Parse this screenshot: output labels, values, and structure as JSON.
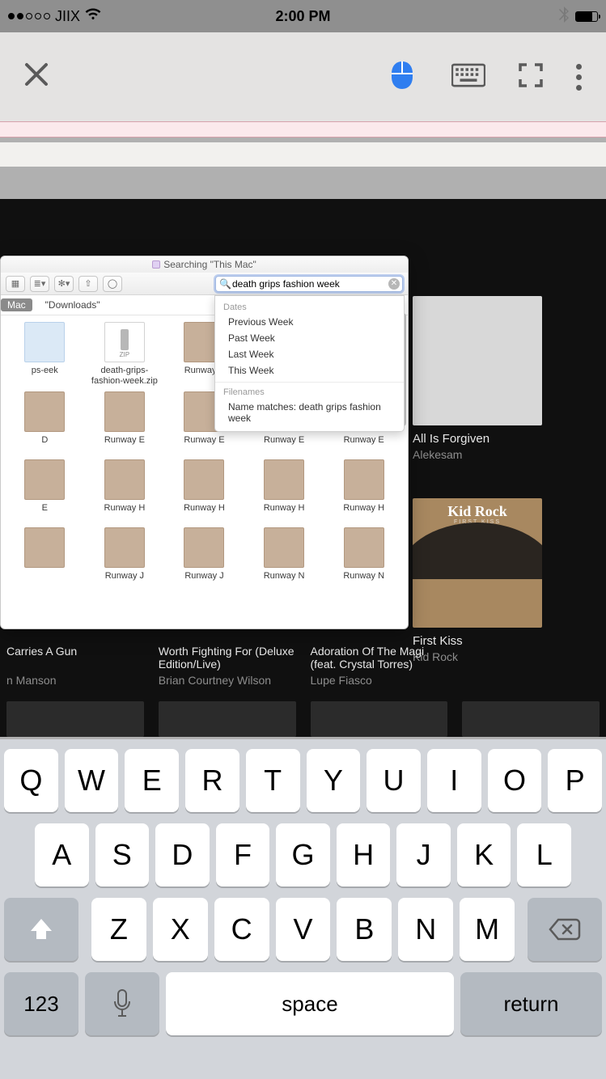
{
  "status": {
    "carrier": "JIIX",
    "time": "2:00 PM"
  },
  "toolbar": {},
  "albums": {
    "a1": {
      "title": "All Is Forgiven",
      "artist": "Alekesam"
    },
    "a2": {
      "art_line1": "Kid Rock",
      "art_line2": "FIRST KISS",
      "title": "First Kiss",
      "artist": "Kid Rock"
    }
  },
  "bottom": [
    {
      "title": "Carries A Gun",
      "artist": "n Manson"
    },
    {
      "title": "Worth Fighting For (Deluxe Edition/Live)",
      "artist": "Brian Courtney Wilson"
    },
    {
      "title": "Adoration Of The Magi (feat. Crystal Torres)",
      "artist": "Lupe Fiasco"
    },
    {
      "title": "",
      "artist": ""
    }
  ],
  "finder": {
    "title": "Searching \"This Mac\"",
    "search_value": "death grips fashion week",
    "scope": {
      "mac": "Mac",
      "downloads": "\"Downloads\""
    },
    "suggestions": {
      "dates_label": "Dates",
      "dates": [
        "Previous Week",
        "Past Week",
        "Last Week",
        "This Week"
      ],
      "filenames_label": "Filenames",
      "filename_match": "Name matches: death grips fashion week"
    },
    "files": [
      {
        "name": "ps-eek",
        "icon": "generic"
      },
      {
        "name": "death-grips-fashion-week.zip",
        "icon": "zip"
      },
      {
        "name": "Runway A",
        "icon": "img"
      },
      {
        "name": "",
        "icon": "none"
      },
      {
        "name": "",
        "icon": "none"
      },
      {
        "name": "D",
        "icon": "img"
      },
      {
        "name": "Runway E",
        "icon": "img"
      },
      {
        "name": "Runway E",
        "icon": "img"
      },
      {
        "name": "Runway E",
        "icon": "img"
      },
      {
        "name": "Runway E",
        "icon": "img"
      },
      {
        "name": "E",
        "icon": "img"
      },
      {
        "name": "Runway H",
        "icon": "img"
      },
      {
        "name": "Runway H",
        "icon": "img"
      },
      {
        "name": "Runway H",
        "icon": "img"
      },
      {
        "name": "Runway H",
        "icon": "img"
      },
      {
        "name": "",
        "icon": "img"
      },
      {
        "name": "Runway J",
        "icon": "img"
      },
      {
        "name": "Runway J",
        "icon": "img"
      },
      {
        "name": "Runway N",
        "icon": "img"
      },
      {
        "name": "Runway N",
        "icon": "img"
      }
    ]
  },
  "keyboard": {
    "row1": [
      "Q",
      "W",
      "E",
      "R",
      "T",
      "Y",
      "U",
      "I",
      "O",
      "P"
    ],
    "row2": [
      "A",
      "S",
      "D",
      "F",
      "G",
      "H",
      "J",
      "K",
      "L"
    ],
    "row3": [
      "Z",
      "X",
      "C",
      "V",
      "B",
      "N",
      "M"
    ],
    "num": "123",
    "space": "space",
    "return": "return"
  }
}
